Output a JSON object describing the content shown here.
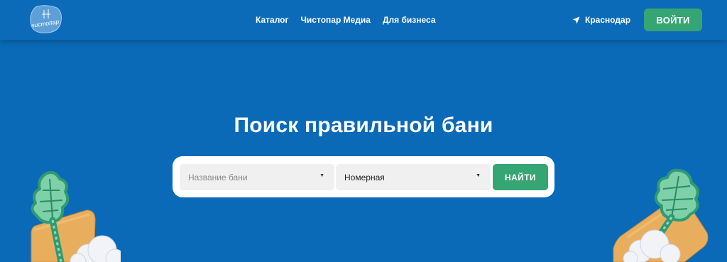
{
  "header": {
    "logo_text": "чистопар",
    "nav": [
      {
        "label": "Каталог"
      },
      {
        "label": "Чистопар Медиа"
      },
      {
        "label": "Для бизнеса"
      }
    ],
    "city": "Краснодар",
    "login_label": "ВОЙТИ"
  },
  "hero": {
    "title": "Поиск правильной бани"
  },
  "search": {
    "name_placeholder": "Название бани",
    "type_value": "Номерная",
    "submit_label": "НАЙТИ"
  },
  "colors": {
    "background": "#0a6ab8",
    "accent_green": "#36a574",
    "field_bg": "#f0f0f0"
  }
}
